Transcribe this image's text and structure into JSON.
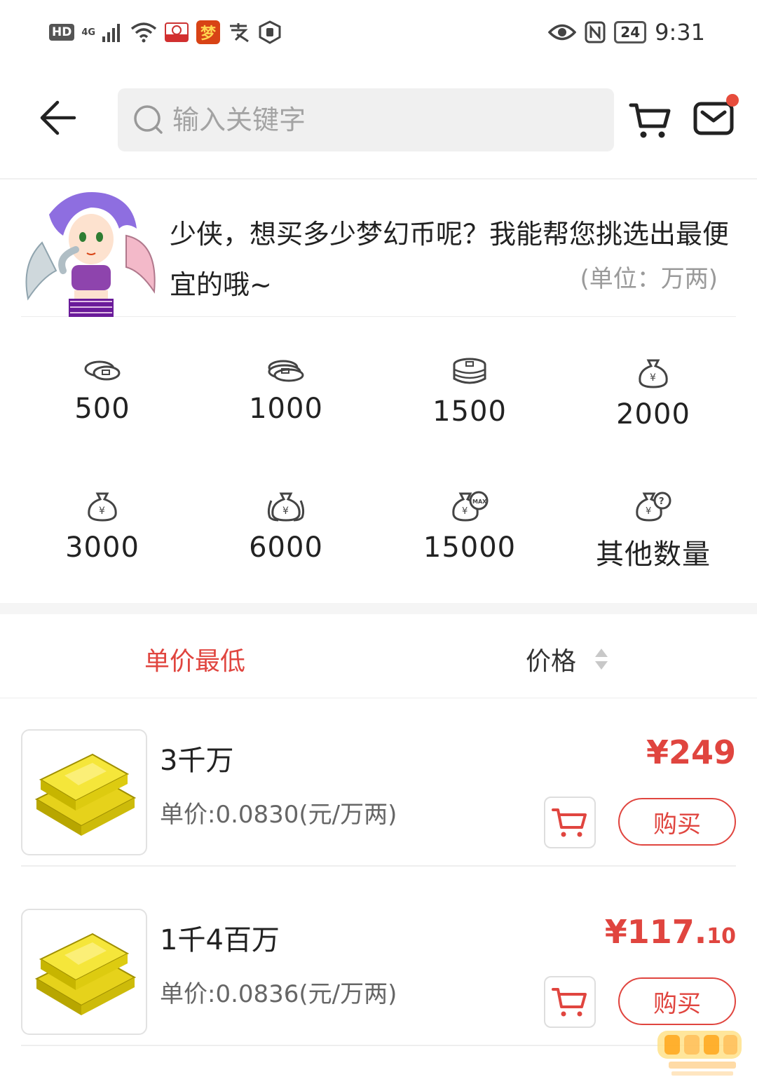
{
  "status_bar": {
    "left_hd": "HD",
    "left_net": "4G",
    "time": "9:31",
    "battery": "24"
  },
  "header": {
    "search_placeholder": "输入关键字"
  },
  "intro": {
    "message": "少侠，想买多少梦幻币呢？我能帮您挑选出最便宜的哦~",
    "unit": "(单位：万两)"
  },
  "amounts": [
    {
      "label": "500",
      "icon": "coins-small-icon"
    },
    {
      "label": "1000",
      "icon": "coins-medium-icon"
    },
    {
      "label": "1500",
      "icon": "coins-stack-icon"
    },
    {
      "label": "2000",
      "icon": "money-bag-icon"
    },
    {
      "label": "3000",
      "icon": "money-bag-icon"
    },
    {
      "label": "6000",
      "icon": "money-bags-icon"
    },
    {
      "label": "15000",
      "icon": "money-bag-max-icon"
    },
    {
      "label": "其他数量",
      "icon": "money-bag-question-icon"
    }
  ],
  "sort": {
    "lowest_unit_price": "单价最低",
    "price": "价格"
  },
  "products": [
    {
      "name": "3千万",
      "unit_price": "单价:0.0830(元/万两)",
      "price_main": "¥249",
      "price_decimal": "",
      "buy_label": "购买"
    },
    {
      "name": "1千4百万",
      "unit_price": "单价:0.0836(元/万两)",
      "price_main": "¥117.",
      "price_decimal": "10",
      "buy_label": "购买"
    }
  ],
  "colors": {
    "accent": "#e0453f",
    "divider": "#eeeeee",
    "search_bg": "#f0f0f0"
  }
}
